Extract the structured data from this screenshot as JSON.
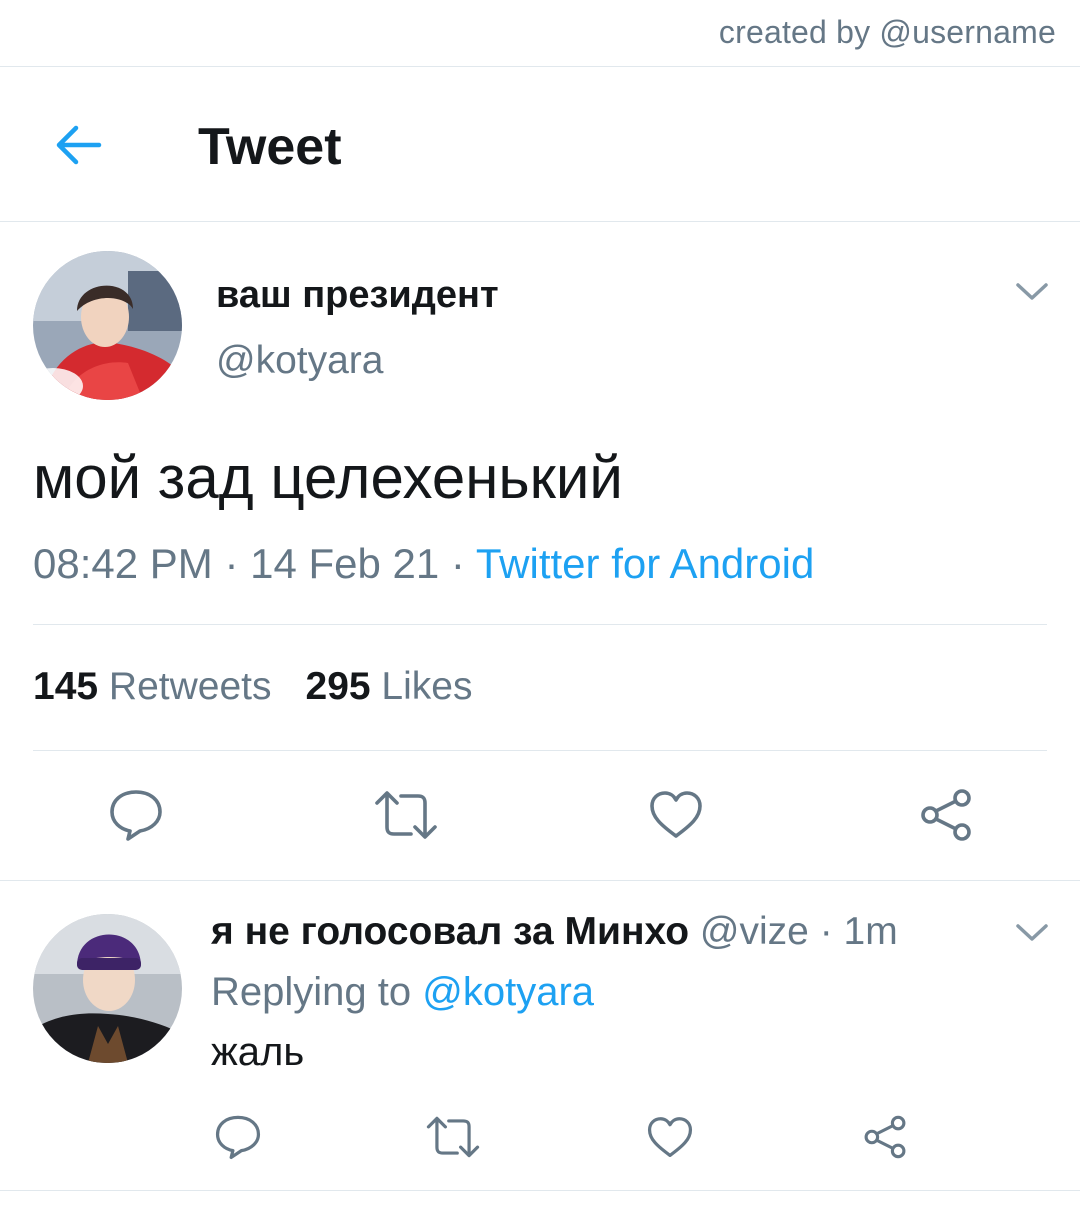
{
  "credit": "created by @username",
  "header": {
    "back_icon": "arrow-left-icon",
    "title": "Tweet"
  },
  "tweet": {
    "display_name": "ваш президент",
    "handle": "@kotyara",
    "text": "мой зад целехенький",
    "time": "08:42 PM",
    "separator": " · ",
    "date": "14 Feb 21",
    "source": "Twitter for Android",
    "stats": {
      "retweets_count": "145",
      "retweets_label": "Retweets",
      "likes_count": "295",
      "likes_label": "Likes"
    },
    "actions": [
      "reply-icon",
      "retweet-icon",
      "like-icon",
      "share-icon"
    ]
  },
  "reply": {
    "display_name": "я не голосовал за Минхо",
    "handle": "@vize",
    "separator": " · ",
    "time": "1m",
    "replying_label": "Replying to",
    "replying_handle": "@kotyara",
    "text": "жаль",
    "actions": [
      "reply-icon",
      "retweet-icon",
      "like-icon",
      "share-icon"
    ]
  },
  "colors": {
    "accent": "#1da1f2",
    "text": "#14171a",
    "secondary": "#657786",
    "divider": "#e1e8ed",
    "icon": "#657786"
  }
}
